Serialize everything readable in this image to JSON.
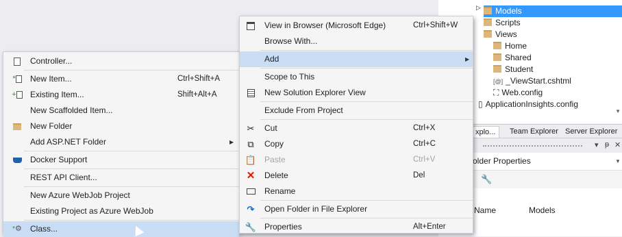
{
  "solution_explorer": {
    "tree": [
      {
        "label": "Models",
        "selected": true,
        "icon": "folder-icon"
      },
      {
        "label": "Scripts",
        "icon": "folder-icon"
      },
      {
        "label": "Views",
        "icon": "folder-open-icon"
      },
      {
        "label": "Home",
        "icon": "folder-icon"
      },
      {
        "label": "Shared",
        "icon": "folder-icon"
      },
      {
        "label": "Student",
        "icon": "folder-icon"
      },
      {
        "label": "_ViewStart.cshtml",
        "icon": "razor-file-icon"
      },
      {
        "label": "Web.config",
        "icon": "config-file-icon"
      },
      {
        "label": "ApplicationInsights.config",
        "icon": "file-icon"
      }
    ],
    "tabs": [
      "xplo...",
      "Team Explorer",
      "Server Explorer"
    ],
    "panel_buttons": {
      "dropdown": "▾",
      "pin": "ᵽ",
      "close": "✕"
    },
    "properties": {
      "title": "older Properties",
      "grid_name_label": "Name",
      "grid_name_value": "Models"
    }
  },
  "add_submenu": {
    "items": [
      {
        "label": "Controller...",
        "icon": "controller-icon"
      },
      {
        "sep": true
      },
      {
        "label": "New Item...",
        "shortcut": "Ctrl+Shift+A",
        "icon": "new-item-icon"
      },
      {
        "label": "Existing Item...",
        "shortcut": "Shift+Alt+A",
        "icon": "existing-item-icon"
      },
      {
        "label": "New Scaffolded Item..."
      },
      {
        "label": "New Folder",
        "icon": "new-folder-icon"
      },
      {
        "label": "Add ASP.NET Folder",
        "submenu": true
      },
      {
        "sep": true
      },
      {
        "label": "Docker Support",
        "icon": "docker-icon"
      },
      {
        "sep": true
      },
      {
        "label": "REST API Client..."
      },
      {
        "sep": true
      },
      {
        "label": "New Azure WebJob Project"
      },
      {
        "label": "Existing Project as Azure WebJob"
      },
      {
        "sep": true
      },
      {
        "label": "Class...",
        "icon": "class-icon",
        "highlighted": true
      }
    ]
  },
  "context_menu": {
    "items": [
      {
        "label": "View in Browser (Microsoft Edge)",
        "shortcut": "Ctrl+Shift+W",
        "icon": "browser-icon"
      },
      {
        "label": "Browse With..."
      },
      {
        "sep": true
      },
      {
        "label": "Add",
        "submenu": true,
        "highlighted": true
      },
      {
        "sep": true
      },
      {
        "label": "Scope to This"
      },
      {
        "label": "New Solution Explorer View",
        "icon": "solution-view-icon"
      },
      {
        "sep": true
      },
      {
        "label": "Exclude From Project"
      },
      {
        "sep": true
      },
      {
        "label": "Cut",
        "shortcut": "Ctrl+X",
        "icon": "cut-icon"
      },
      {
        "label": "Copy",
        "shortcut": "Ctrl+C",
        "icon": "copy-icon"
      },
      {
        "label": "Paste",
        "shortcut": "Ctrl+V",
        "icon": "paste-icon",
        "disabled": true
      },
      {
        "label": "Delete",
        "shortcut": "Del",
        "icon": "delete-icon"
      },
      {
        "label": "Rename",
        "icon": "rename-icon"
      },
      {
        "sep": true
      },
      {
        "label": "Open Folder in File Explorer",
        "icon": "open-folder-icon"
      },
      {
        "sep": true
      },
      {
        "label": "Properties",
        "shortcut": "Alt+Enter",
        "icon": "properties-icon"
      }
    ]
  },
  "colors": {
    "highlight": "#c9def5",
    "tree_selection": "#3399ff",
    "delete_red": "#e51400"
  }
}
